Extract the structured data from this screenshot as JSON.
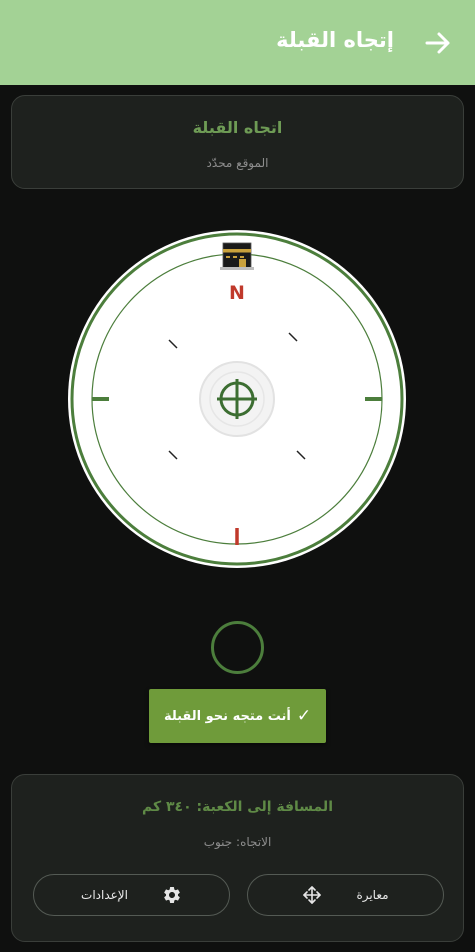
{
  "appbar": {
    "title": "إتجاه القبلة"
  },
  "info": {
    "heading": "اتجاه القبلة",
    "location": "الموقع محدّد"
  },
  "compass": {
    "north_label": "N"
  },
  "status": {
    "label": "أنت متجه نحو القبلة",
    "check": "✓"
  },
  "bottom": {
    "distance": "المسافة إلى الكعبة: ٣٤٠ كم",
    "direction": "الاتجاه: جنوب",
    "calibrate_label": "معايرة",
    "settings_label": "الإعدادات"
  },
  "colors": {
    "appbar": "#a3d295",
    "accent": "#5f8a46",
    "button": "#6f9b3a",
    "north": "#c0392b"
  }
}
